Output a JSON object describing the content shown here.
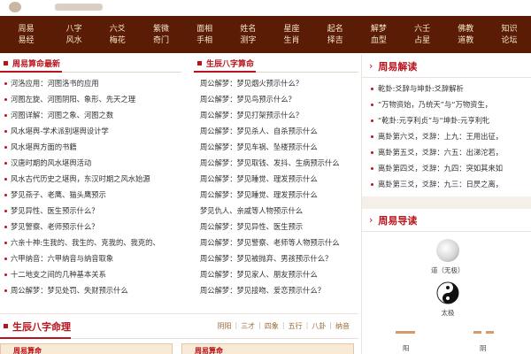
{
  "nav": [
    [
      "周易",
      "易经"
    ],
    [
      "八字",
      "风水"
    ],
    [
      "六爻",
      "梅花"
    ],
    [
      "紫微",
      "奇门"
    ],
    [
      "面相",
      "手相"
    ],
    [
      "姓名",
      "测字"
    ],
    [
      "星座",
      "生肖"
    ],
    [
      "起名",
      "择吉"
    ],
    [
      "解梦",
      "血型"
    ],
    [
      "六壬",
      "占星"
    ],
    [
      "佛教",
      "道教"
    ],
    [
      "知识",
      "论坛"
    ]
  ],
  "left_section": {
    "title": "周易算命最新",
    "items": [
      "河洛应用：河图洛书的应用",
      "河图左旋、河图阴阳、象形、先天之理",
      "河图详解：河图之象、河图之数",
      "风水堪舆-学术派别堪舆设计学",
      "风水堪舆方面的书籍",
      "汉唐时期的风水堪舆活动",
      "风水古代历史之堪舆，东汉时期之风水始源",
      "梦见燕子、老鹰、猫头鹰预示",
      "梦见异性、医生预示什么？",
      "梦见警察、老师预示什么？",
      "六亲十神:生我的、我生的、克我的、我克的、",
      "六甲纳音：六甲纳音与纳音取象",
      "十二地支之间的几种基本关系",
      "周公解梦：梦见处罚、失财预示什么"
    ]
  },
  "mid_section": {
    "title": "生辰八字算命",
    "items": [
      "周公解梦：梦见烟火预示什么？",
      "周公解梦：梦见鸟预示什么？",
      "周公解梦：梦见打架预示什么？",
      "周公解梦：梦见杀人、自杀预示什么",
      "周公解梦：梦见车祸、坠楼预示什么",
      "周公解梦：梦见取钱、发抖、生病预示什么",
      "周公解梦：梦见睡觉、理发预示什么",
      "周公解梦：梦见睡觉、理发预示什么",
      "梦见仇人、亲戚等人物预示什么",
      "周公解梦：梦见异性、医生预示",
      "周公解梦：梦见警察、老师等人物预示什么",
      "周公解梦：梦见被抛弃、男孩预示什么？",
      "周公解梦：梦见家人、朋友预示什么",
      "周公解梦：梦见接吻、爱恋预示什么？"
    ]
  },
  "right_read": {
    "title": "周易解读",
    "items": [
      "乾卦:爻辞与坤卦:爻辞解析",
      "“万物资始，乃统天”与“万物资生，",
      "“乾卦:元亨利贞”与“坤卦:元亨利牝",
      "离卦第六爻，爻辞：上九：王用出征，",
      "离卦第五爻，爻辞：六五：出涕沱若，",
      "离卦第四爻，爻辞：九四：突如其来如",
      "离卦第三爻，爻辞：九三：日昃之离，"
    ]
  },
  "right_guide": {
    "title": "周易导读",
    "items": [
      {
        "label": "道（无极）",
        "icon": "wuji-icon"
      },
      {
        "label": "太极",
        "icon": "taiji-icon"
      }
    ],
    "yinyang": [
      "阳",
      "阴"
    ]
  },
  "bottom": {
    "title": "生辰八字命理",
    "tabs": [
      "阴阳",
      "三才",
      "四象",
      "五行",
      "八卦",
      "纳音"
    ],
    "cards": [
      "周易算命",
      "周易算命"
    ]
  },
  "colors": {
    "nav_bg": "#5b1c06",
    "nav_text": "#f4e4c8",
    "accent": "#b8141c",
    "tab_text": "#9a6b3a"
  }
}
